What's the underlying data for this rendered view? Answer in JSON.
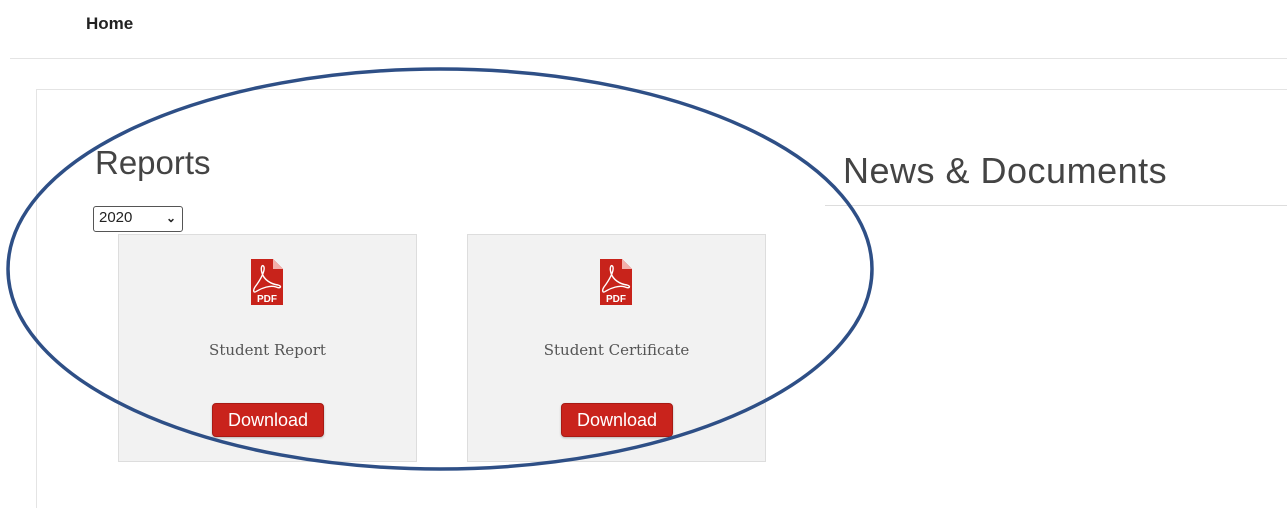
{
  "nav": {
    "home_label": "Home"
  },
  "reports": {
    "heading": "Reports",
    "year_selected": "2020",
    "cards": [
      {
        "title": "Student Report",
        "icon": "pdf-icon",
        "icon_text": "PDF",
        "button_label": "Download"
      },
      {
        "title": "Student Certificate",
        "icon": "pdf-icon",
        "icon_text": "PDF",
        "button_label": "Download"
      }
    ]
  },
  "news": {
    "heading": "News & Documents"
  },
  "colors": {
    "button_red": "#c9231c",
    "pdf_red": "#c8231b",
    "card_bg": "#f2f2f2",
    "annotation_blue": "#2e4f86"
  }
}
